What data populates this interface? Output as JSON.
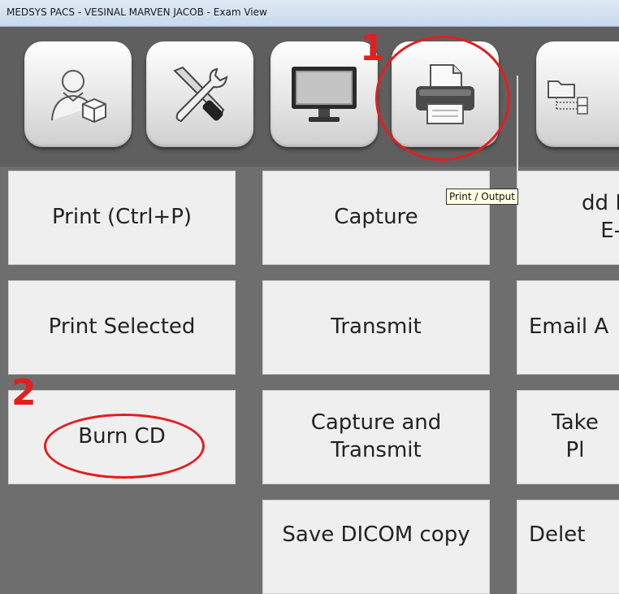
{
  "window": {
    "title": "MEDSYS PACS - VESINAL MARVEN JACOB - Exam View"
  },
  "toolbar": {
    "buttons": [
      {
        "name": "patient-icon"
      },
      {
        "name": "tools-icon"
      },
      {
        "name": "monitor-icon"
      },
      {
        "name": "printer-icon"
      },
      {
        "name": "folder-tree-icon"
      }
    ]
  },
  "tooltip": {
    "text": "Print / Output"
  },
  "buttons": {
    "print": "Print (Ctrl+P)",
    "capture": "Capture",
    "add_e": "dd I\nE-",
    "print_selected": "Print Selected",
    "transmit": "Transmit",
    "email": "Email A",
    "burn_cd": "Burn CD",
    "capture_transmit": "Capture and\nTransmit",
    "take": "Take\nPl",
    "save_dicom": "Save DICOM copy",
    "delete": "Delet"
  },
  "annotations": {
    "one": "1",
    "two": "2",
    "color": "#e31e1e"
  }
}
